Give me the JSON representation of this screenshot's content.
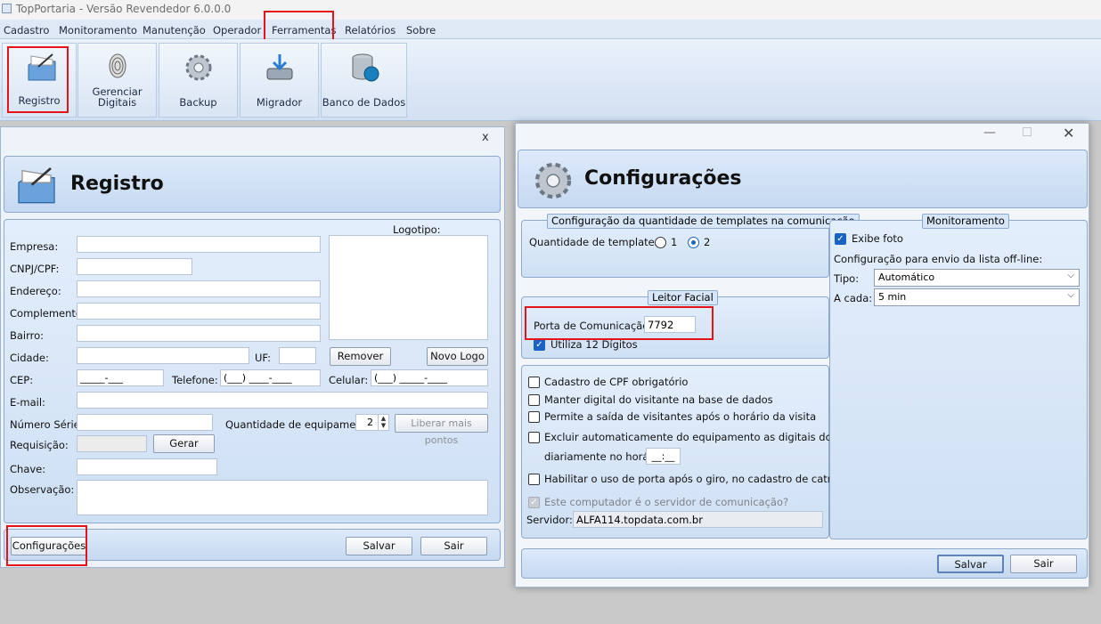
{
  "app": {
    "title": "TopPortaria - Versão Revendedor 6.0.0.0"
  },
  "menu": [
    "Cadastro",
    "Monitoramento",
    "Manutenção",
    "Operador",
    "Ferramentas",
    "Relatórios",
    "Sobre"
  ],
  "toolbar": {
    "registro": "Registro",
    "gerenciar_1": "Gerenciar",
    "gerenciar_2": "Digitais",
    "backup": "Backup",
    "migrador": "Migrador",
    "banco": "Banco de Dados"
  },
  "registro": {
    "close": "x",
    "title": "Registro",
    "logotipo": "Logotipo:",
    "labels": {
      "empresa": "Empresa:",
      "cnpj": "CNPJ/CPF:",
      "endereco": "Endereço:",
      "complemento": "Complemento:",
      "bairro": "Bairro:",
      "cidade": "Cidade:",
      "uf": "UF:",
      "cep": "CEP:",
      "telefone": "Telefone:",
      "celular": "Celular:",
      "email": "E-mail:",
      "numero_serie": "Número Série:",
      "qtd_equip": "Quantidade de equipamentos:",
      "requisicao": "Requisição:",
      "chave": "Chave:",
      "observacao": "Observação:"
    },
    "masks": {
      "cep": "_____-___",
      "telefone": "(___) ____-____",
      "celular": "(___) _____-____"
    },
    "qtd_equip_value": "2",
    "buttons": {
      "remover": "Remover",
      "novo_logo": "Novo Logo",
      "liberar": "Liberar mais pontos",
      "gerar": "Gerar",
      "configuracoes": "Configurações",
      "salvar": "Salvar",
      "sair": "Sair"
    }
  },
  "config": {
    "title": "Configurações",
    "group_templates": "Configuração da quantidade de templates na comunicação",
    "qtd_templates_label": "Quantidade de templates:",
    "radio_1": "1",
    "radio_2": "2",
    "group_leitor": "Leitor Facial",
    "porta_label": "Porta de Comunicação:",
    "porta_value": "7792",
    "utiliza_12": "Utiliza 12 Dígitos",
    "opt_cpf": "Cadastro de CPF obrigatório",
    "opt_manter": "Manter digital do visitante na base de dados",
    "opt_permite": "Permite a saída de visitantes após o horário da visita",
    "opt_excluir": "Excluir automaticamente do equipamento as digitais dos visitantes",
    "opt_diariamente": "diariamente no horário:",
    "horario_mask": "__:__",
    "opt_habilitar": "Habilitar o uso de porta após o giro, no cadastro de catraca",
    "opt_servidor": "Este computador é o servidor de comunicação?",
    "servidor_label": "Servidor:",
    "servidor_value": "ALFA114.topdata.com.br",
    "group_monit": "Monitoramento",
    "exibe_foto": "Exibe foto",
    "offline_label": "Configuração para envio da lista off-line:",
    "tipo_label": "Tipo:",
    "tipo_value": "Automático",
    "acada_label": "A cada:",
    "acada_value": "5 min",
    "salvar": "Salvar",
    "sair": "Sair"
  }
}
